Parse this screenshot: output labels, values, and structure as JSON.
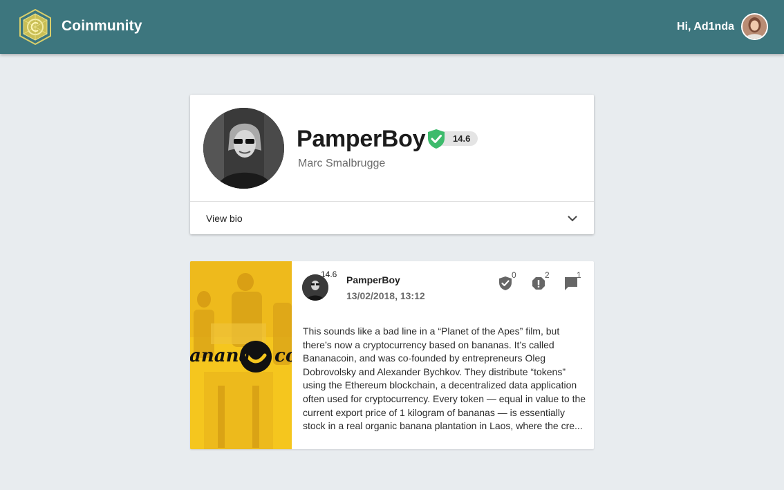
{
  "header": {
    "app_title": "Coinmunity",
    "greeting": "Hi, Ad1nda",
    "logo_icon": "coin-hexagon-logo",
    "colors": {
      "bar": "#3d767e",
      "logo": "#d9cf6b"
    }
  },
  "profile": {
    "username": "PamperBoy",
    "real_name": "Marc Smalbrugge",
    "score": "14.6",
    "verified_icon": "shield-check-icon",
    "verified_color": "#3dbb6c",
    "view_bio_label": "View bio"
  },
  "post": {
    "author": "PamperBoy",
    "author_score": "14.6",
    "date": "13/02/2018, 13:12",
    "image_text_left": "anana",
    "image_text_right": "co",
    "body": "This sounds like a bad line in a “Planet of the Apes” film, but there’s now a cryptocurrency based on bananas. It’s called Bananacoin, and was co-founded by entrepreneurs Oleg Dobrovolsky and Alexander Bychkov. They distribute “tokens” using the Ethereum blockchain, a decentralized data application often used for cryptocurrency. Every token — equal in value to the current export price of 1 kilogram of bananas — is essentially stock in a real organic banana plantation in Laos, where the cre...",
    "actions": {
      "verify_count": "0",
      "report_count": "2",
      "comment_count": "1"
    }
  }
}
